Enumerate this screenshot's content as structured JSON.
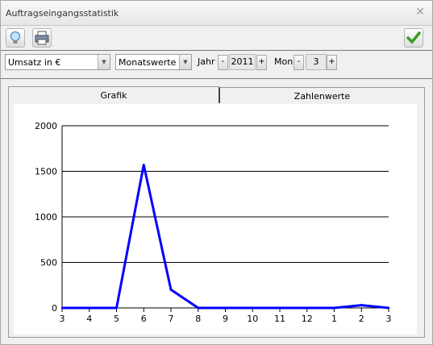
{
  "window": {
    "title": "Auftragseingangsstatistik",
    "close_glyph": "✕"
  },
  "toolbar": {
    "hint_icon": "lightbulb-icon",
    "print_icon": "printer-icon",
    "ok_icon": "checkmark-icon"
  },
  "controls": {
    "measure": "Umsatz in €",
    "mode": "Monatswerte",
    "year_label": "Jahr",
    "year_minus": "-",
    "year_value": "2011",
    "year_plus": "+",
    "month_label": "Mon",
    "month_minus": "-",
    "month_value": "3",
    "month_plus": "+"
  },
  "tabs": [
    {
      "label": "Grafik",
      "active": true
    },
    {
      "label": "Zahlenwerte",
      "active": false
    }
  ],
  "chart_data": {
    "type": "line",
    "categories": [
      "3",
      "4",
      "5",
      "6",
      "7",
      "8",
      "9",
      "10",
      "11",
      "12",
      "1",
      "2",
      "3"
    ],
    "series": [
      {
        "values": [
          0,
          0,
          0,
          1570,
          200,
          0,
          0,
          0,
          0,
          0,
          0,
          30,
          0
        ],
        "color": "#0000ff"
      }
    ],
    "ylim": [
      0,
      2000
    ],
    "yticks": [
      "0",
      "500",
      "1000",
      "1500",
      "2000"
    ],
    "ytick_values": [
      0,
      500,
      1000,
      1500,
      2000
    ],
    "grid": true
  }
}
